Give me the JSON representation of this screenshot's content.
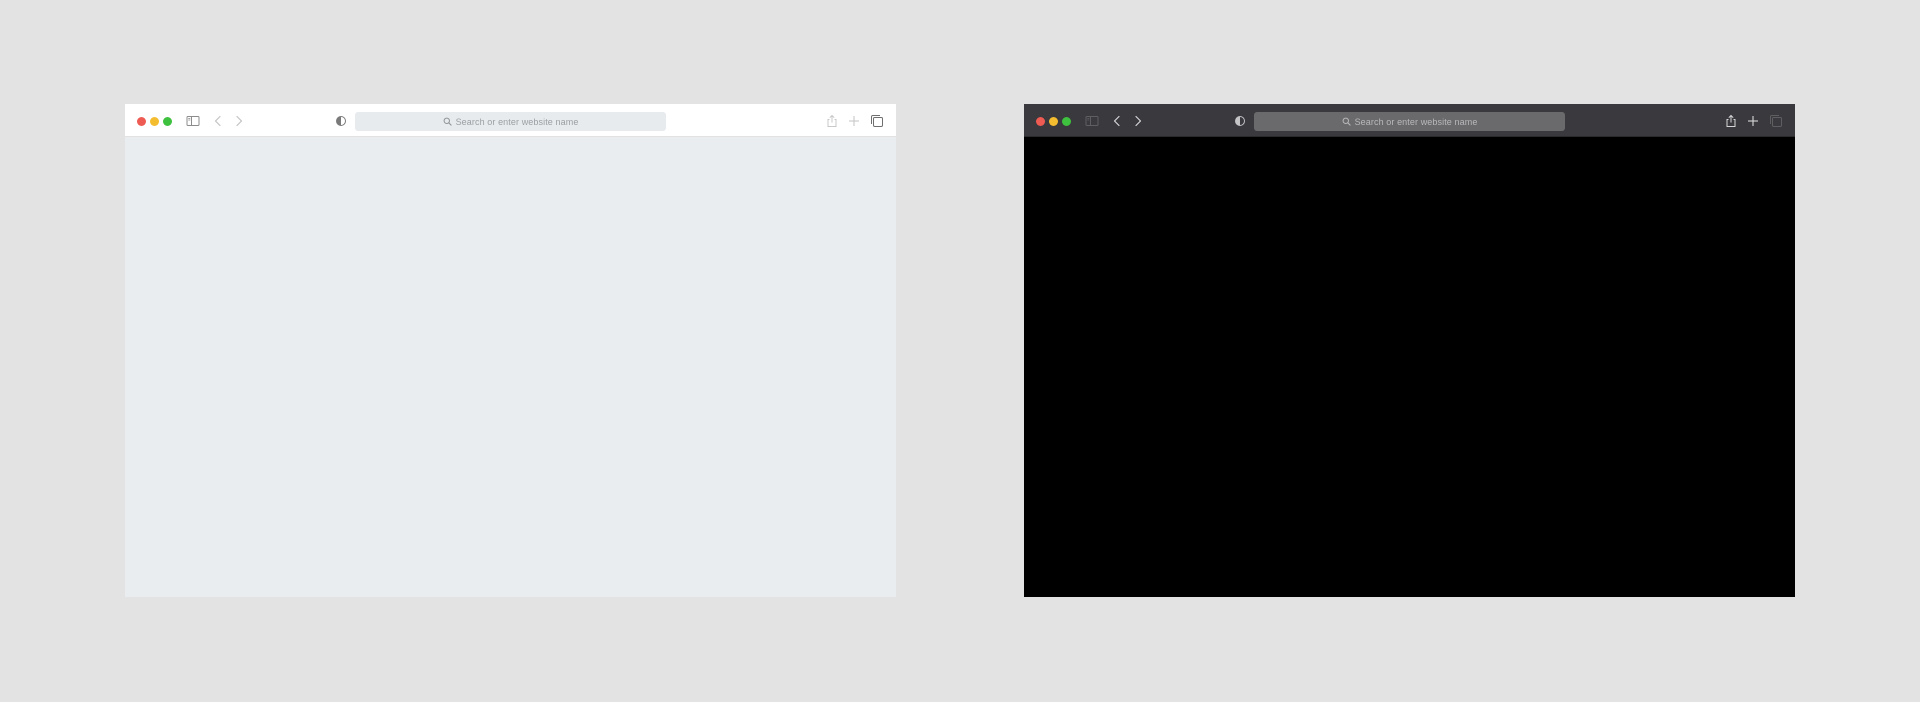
{
  "colors": {
    "page_background": "#e3e3e3",
    "traffic_close": "#ee5b53",
    "traffic_minimize": "#f4bc2f",
    "traffic_zoom": "#3ec13f"
  },
  "windows": [
    {
      "theme": "light",
      "toolbar": {
        "icons": [
          "sidebar-icon",
          "back-chevron-icon",
          "forward-chevron-icon",
          "appearance-icon",
          "share-icon",
          "new-tab-plus-icon",
          "tab-overview-icon"
        ]
      },
      "address_bar": {
        "placeholder": "Search or enter website name"
      },
      "content_color": "#e9edf0"
    },
    {
      "theme": "dark",
      "toolbar": {
        "icons": [
          "sidebar-icon",
          "back-chevron-icon",
          "forward-chevron-icon",
          "appearance-icon",
          "share-icon",
          "new-tab-plus-icon",
          "tab-overview-icon"
        ]
      },
      "address_bar": {
        "placeholder": "Search or enter website name"
      },
      "content_color": "#000000"
    }
  ]
}
